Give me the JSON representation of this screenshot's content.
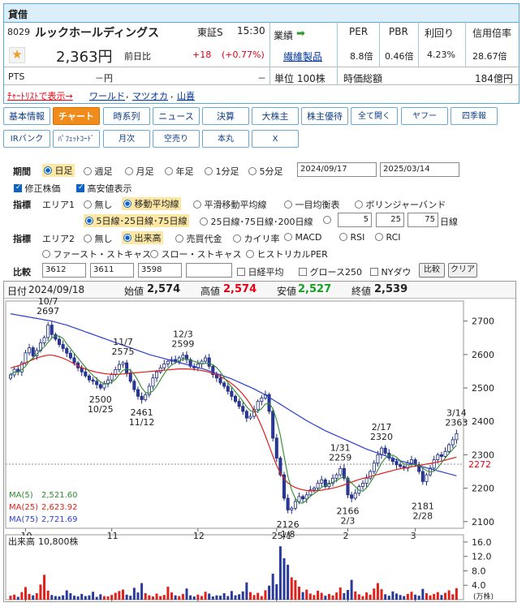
{
  "header": {
    "section": "貸借",
    "code": "8029",
    "name": "ルックホールディングス",
    "market": "東証S",
    "time": "15:30",
    "price": "2,363円",
    "prev_label": "前日比",
    "change": "+18",
    "change_pct": "(+0.77%)",
    "pts_label": "PTS",
    "pts_value": "－円",
    "pts_dash": "－",
    "industry_label": "業績",
    "industry": "繊維製品",
    "unit": "単位 100株",
    "metrics": [
      {
        "label": "PER",
        "value": "8.8倍"
      },
      {
        "label": "PBR",
        "value": "0.46倍"
      },
      {
        "label": "利回り",
        "value": "4.23%"
      },
      {
        "label": "信用倍率",
        "value": "28.67倍"
      }
    ],
    "mcap_label": "時価総額",
    "mcap": "184億円",
    "watch_link": "ﾁｬｰﾄﾘｽﾄで表示→",
    "related": [
      "ワールド",
      "マツオカ",
      "山喜"
    ]
  },
  "tabs_row1": [
    "基本情報",
    "チャート",
    "時系列",
    "ニュース",
    "決算",
    "大株主",
    "株主優待",
    "全て開く",
    "ヤフー",
    "四季報"
  ],
  "tabs_row2": [
    "IRバンク",
    "ﾊﾟﾌｪｯﾄｺｰﾄﾞ",
    "月次",
    "空売り",
    "本丸",
    "X"
  ],
  "controls": {
    "period_label": "期間",
    "periods": [
      "日足",
      "週足",
      "月足",
      "年足",
      "1分足",
      "5分足"
    ],
    "date_from": "2024/09/17",
    "date_to": "2025/03/14",
    "adjusted": "修正株価",
    "highlow": "高安値表示",
    "indicator_label": "指標",
    "area1": "エリア1",
    "area1_opts": [
      "無し",
      "移動平均線",
      "平滑移動平均線",
      "一目均衡表",
      "ボリンジャーバンド"
    ],
    "ma_opts": [
      "5日線･25日線･75日線",
      "25日線･75日線･200日線"
    ],
    "ma_custom": [
      "5",
      "25",
      "75"
    ],
    "ma_unit": "日線",
    "area2": "エリア2",
    "area2_opts": [
      "無し",
      "出来高",
      "売買代金",
      "カイリ率",
      "MACD",
      "RSI",
      "RCI"
    ],
    "area2_opts_b": [
      "ファースト・ストキャス",
      "スロー・ストキャス",
      "ヒストリカルPER"
    ],
    "compare_label": "比較",
    "compare_codes": [
      "3612",
      "3611",
      "3598",
      ""
    ],
    "compare_opts": [
      "日経平均",
      "グロース250",
      "NYダウ"
    ],
    "compare_btn": "比較",
    "clear_btn": "クリア"
  },
  "ohlc_bar": {
    "date_label": "日付",
    "date": "2024/09/18",
    "open_label": "始値",
    "open": "2,574",
    "high_label": "高値",
    "high": "2,574",
    "low_label": "安値",
    "low": "2,527",
    "close_label": "終値",
    "close": "2,539"
  },
  "chart_data": {
    "type": "candlestick",
    "ylim": [
      2080,
      2760
    ],
    "y_ticks": [
      2100,
      2200,
      2300,
      2400,
      2500,
      2600,
      2700
    ],
    "x_labels": [
      "10",
      "11",
      "12",
      "25/1",
      "2",
      "3"
    ],
    "current_price_line": 2272,
    "annotations": [
      {
        "label": "10/7",
        "value": "2697"
      },
      {
        "label": "11/7",
        "value": "2575"
      },
      {
        "label": "12/3",
        "value": "2599"
      },
      {
        "label": "2500",
        "value": "10/25"
      },
      {
        "label": "2461",
        "value": "11/12"
      },
      {
        "label": "1/31",
        "value": "2259"
      },
      {
        "label": "2/17",
        "value": "2320"
      },
      {
        "label": "3/14",
        "value": "2363"
      },
      {
        "label": "2126",
        "value": "1/8"
      },
      {
        "label": "2166",
        "value": "2/3"
      },
      {
        "label": "2181",
        "value": "2/28"
      }
    ],
    "ma_legend": [
      {
        "name": "MA(5)",
        "value": "2,521.60",
        "color": "#2e8b2e"
      },
      {
        "name": "MA(25)",
        "value": "2,623.92",
        "color": "#e0201b"
      },
      {
        "name": "MA(75)",
        "value": "2,721.69",
        "color": "#2a3fd1"
      }
    ],
    "closes": [
      2539,
      2556,
      2548,
      2575,
      2605,
      2620,
      2596,
      2612,
      2635,
      2651,
      2688,
      2660,
      2646,
      2630,
      2618,
      2604,
      2590,
      2575,
      2560,
      2548,
      2536,
      2524,
      2520,
      2510,
      2500,
      2512,
      2524,
      2540,
      2555,
      2570,
      2575,
      2545,
      2520,
      2495,
      2475,
      2465,
      2480,
      2505,
      2530,
      2548,
      2560,
      2572,
      2580,
      2585,
      2578,
      2590,
      2598,
      2585,
      2565,
      2560,
      2572,
      2580,
      2590,
      2565,
      2540,
      2530,
      2515,
      2505,
      2490,
      2475,
      2460,
      2445,
      2430,
      2410,
      2415,
      2435,
      2460,
      2470,
      2480,
      2430,
      2350,
      2290,
      2240,
      2170,
      2135,
      2140,
      2160,
      2175,
      2168,
      2180,
      2195,
      2200,
      2215,
      2225,
      2205,
      2215,
      2230,
      2240,
      2259,
      2230,
      2180,
      2170,
      2185,
      2205,
      2215,
      2230,
      2250,
      2275,
      2300,
      2320,
      2305,
      2290,
      2280,
      2270,
      2265,
      2260,
      2275,
      2285,
      2270,
      2250,
      2220,
      2240,
      2260,
      2285,
      2300,
      2295,
      2310,
      2330,
      2345,
      2363
    ],
    "ma25": [
      2560,
      2563,
      2566,
      2570,
      2575,
      2580,
      2585,
      2590,
      2593,
      2596,
      2598,
      2598,
      2596,
      2593,
      2589,
      2584,
      2578,
      2572,
      2566,
      2561,
      2557,
      2553,
      2550,
      2547,
      2545,
      2543,
      2542,
      2541,
      2541,
      2541,
      2542,
      2543,
      2544,
      2545,
      2546,
      2547,
      2548,
      2549,
      2550,
      2551,
      2552,
      2553,
      2554,
      2555,
      2556,
      2557,
      2557,
      2557,
      2556,
      2555,
      2554,
      2552,
      2550,
      2547,
      2543,
      2539,
      2534,
      2528,
      2521,
      2513,
      2504,
      2493,
      2481,
      2467,
      2451,
      2432,
      2410,
      2385,
      2357,
      2327,
      2296,
      2268,
      2245,
      2228,
      2216,
      2208,
      2202,
      2198,
      2195,
      2193,
      2192,
      2192,
      2193,
      2194,
      2196,
      2198,
      2200,
      2203,
      2206,
      2210,
      2214,
      2218,
      2222,
      2226,
      2229,
      2232,
      2235,
      2238,
      2241,
      2244,
      2247,
      2250,
      2253,
      2256,
      2258,
      2260,
      2262,
      2264,
      2266,
      2268,
      2270,
      2272,
      2274,
      2276,
      2278,
      2281,
      2284,
      2287,
      2290,
      2293
    ],
    "ma75": [
      2722,
      2720,
      2718,
      2716,
      2714,
      2712,
      2710,
      2708,
      2706,
      2704,
      2702,
      2700,
      2697,
      2694,
      2691,
      2688,
      2684,
      2680,
      2676,
      2672,
      2668,
      2664,
      2660,
      2656,
      2652,
      2648,
      2644,
      2640,
      2636,
      2632,
      2628,
      2624,
      2620,
      2616,
      2612,
      2608,
      2604,
      2600,
      2597,
      2594,
      2591,
      2588,
      2585,
      2582,
      2579,
      2576,
      2573,
      2570,
      2567,
      2564,
      2561,
      2558,
      2555,
      2551,
      2547,
      2543,
      2539,
      2535,
      2531,
      2527,
      2522,
      2517,
      2512,
      2507,
      2502,
      2497,
      2491,
      2485,
      2479,
      2472,
      2465,
      2458,
      2451,
      2444,
      2437,
      2430,
      2423,
      2416,
      2409,
      2402,
      2396,
      2390,
      2384,
      2378,
      2372,
      2367,
      2362,
      2357,
      2352,
      2347,
      2342,
      2337,
      2332,
      2327,
      2322,
      2317,
      2313,
      2309,
      2305,
      2301,
      2297,
      2293,
      2289,
      2285,
      2282,
      2279,
      2276,
      2273,
      2270,
      2267,
      2264,
      2261,
      2258,
      2255,
      2252,
      2249,
      2246,
      2243,
      2240,
      2237
    ],
    "volume_label": "出来高",
    "volume_value": "10,800株",
    "volume_ticks": [
      "16.0",
      "12.0",
      "8.0",
      "4.0"
    ],
    "volume_unit": "(万株)",
    "volume_ylim": [
      0,
      18
    ],
    "volumes": [
      1.1,
      1.4,
      0.8,
      2.1,
      3.5,
      1.6,
      1.2,
      1.8,
      4.2,
      6.9,
      2.5,
      1.3,
      1.0,
      0.9,
      1.2,
      2.6,
      1.8,
      1.1,
      0.9,
      1.6,
      1.0,
      1.2,
      2.2,
      0.8,
      1.5,
      1.0,
      0.9,
      1.3,
      1.9,
      2.4,
      2.8,
      1.4,
      1.1,
      3.3,
      2.0,
      4.6,
      1.8,
      1.2,
      0.9,
      1.7,
      1.0,
      1.3,
      3.6,
      2.0,
      1.2,
      1.0,
      1.6,
      3.1,
      1.2,
      0.9,
      1.4,
      1.0,
      2.2,
      1.7,
      0.9,
      1.2,
      1.1,
      1.8,
      1.0,
      2.4,
      1.2,
      1.5,
      2.3,
      4.8,
      2.1,
      1.3,
      1.9,
      1.0,
      2.6,
      3.9,
      7.2,
      4.3,
      14.8,
      11.5,
      9.7,
      6.2,
      5.4,
      3.6,
      2.1,
      2.8,
      1.7,
      1.3,
      2.5,
      1.9,
      1.1,
      1.6,
      1.2,
      2.0,
      3.4,
      1.8,
      2.7,
      5.5,
      2.3,
      1.5,
      1.0,
      2.0,
      1.4,
      3.1,
      4.6,
      2.9,
      1.5,
      1.1,
      2.3,
      1.7,
      1.3,
      1.0,
      1.6,
      2.2,
      1.4,
      1.1,
      3.0,
      1.8,
      1.2,
      1.6,
      2.1,
      1.3,
      1.9,
      2.6,
      1.5,
      3.2
    ]
  }
}
